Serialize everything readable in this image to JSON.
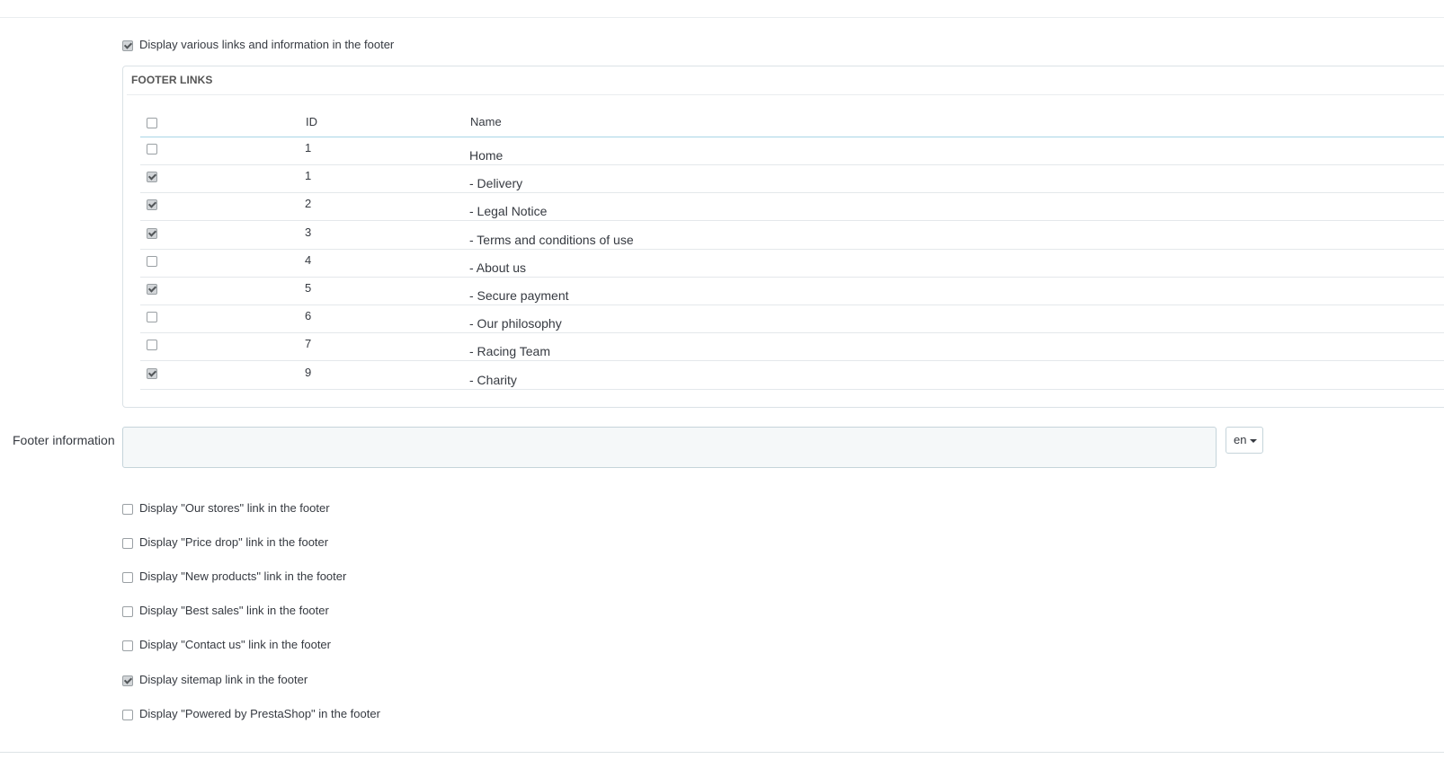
{
  "display_footer_links": {
    "label": "Display various links and information in the footer",
    "checked": true
  },
  "footer_links": {
    "title": "FOOTER LINKS",
    "columns": {
      "id": "ID",
      "name": "Name"
    },
    "rows": [
      {
        "id": "1",
        "name": "Home",
        "checked": false
      },
      {
        "id": "1",
        "name": "- Delivery",
        "checked": true
      },
      {
        "id": "2",
        "name": "- Legal Notice",
        "checked": true
      },
      {
        "id": "3",
        "name": "- Terms and conditions of use",
        "checked": true
      },
      {
        "id": "4",
        "name": "- About us",
        "checked": false
      },
      {
        "id": "5",
        "name": "- Secure payment",
        "checked": true
      },
      {
        "id": "6",
        "name": "- Our philosophy",
        "checked": false
      },
      {
        "id": "7",
        "name": "- Racing Team",
        "checked": false
      },
      {
        "id": "9",
        "name": "- Charity",
        "checked": true
      }
    ]
  },
  "footer_information": {
    "label": "Footer information",
    "value": "",
    "language": "en"
  },
  "options": [
    {
      "label": "Display \"Our stores\" link in the footer",
      "checked": false
    },
    {
      "label": "Display \"Price drop\" link in the footer",
      "checked": false
    },
    {
      "label": "Display \"New products\" link in the footer",
      "checked": false
    },
    {
      "label": "Display \"Best sales\" link in the footer",
      "checked": false
    },
    {
      "label": "Display \"Contact us\" link in the footer",
      "checked": false
    },
    {
      "label": "Display sitemap link in the footer",
      "checked": true
    },
    {
      "label": "Display \"Powered by PrestaShop\" in the footer",
      "checked": false
    }
  ]
}
